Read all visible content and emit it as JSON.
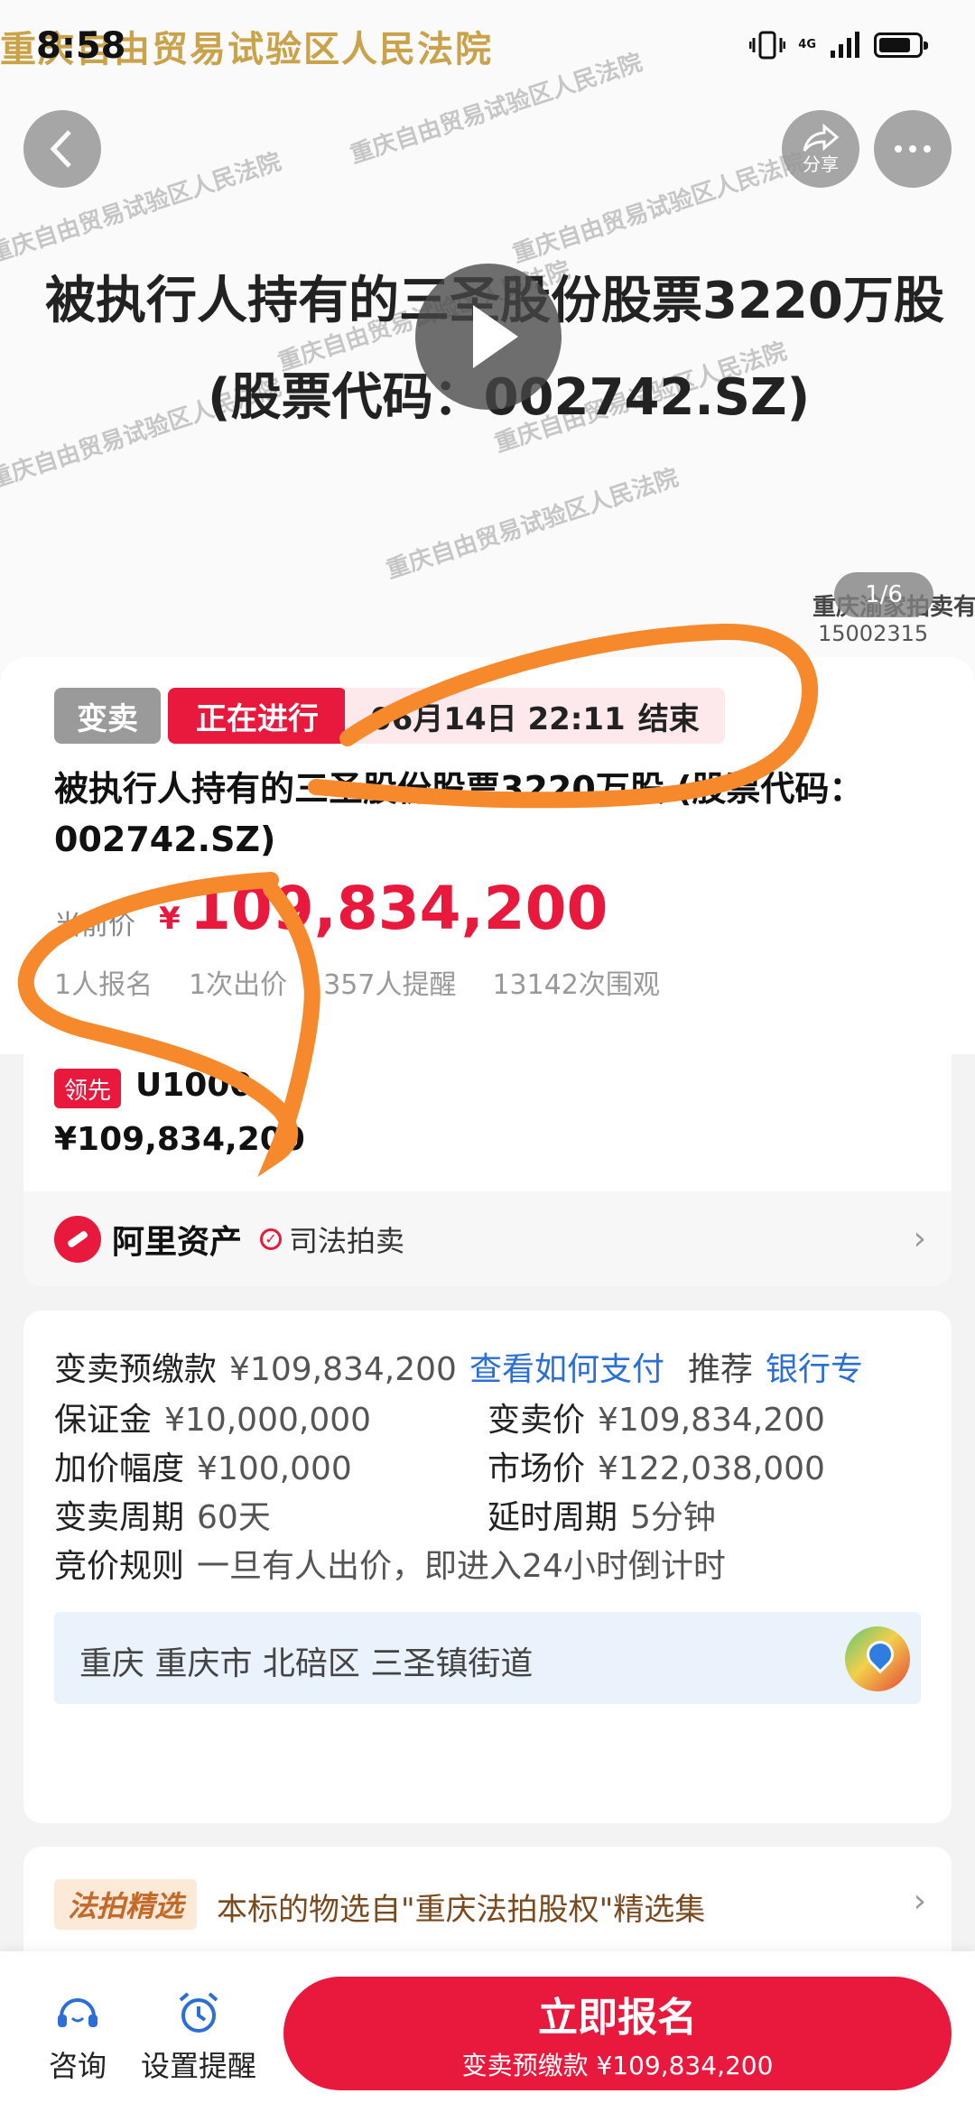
{
  "status_bar": {
    "time": "8:58",
    "banner": "重庆自由贸易试验区人民法院",
    "network": "4G"
  },
  "hero": {
    "watermark": "重庆自由贸易试验区人民法院",
    "title": "被执行人持有的三圣股份股票3220万股",
    "code": "(股票代码：002742.SZ)",
    "share_label": "分享",
    "page_counter": "1/6",
    "seller": "重庆渝家拍卖有",
    "phone": "15002315"
  },
  "info": {
    "tag_type": "变卖",
    "tag_status": "正在进行",
    "end_date": "06月14日 22:11",
    "end_suffix": "结束",
    "title": "被执行人持有的三圣股份股票3220万股 (股票代码：002742.SZ)",
    "price_label": "当前价",
    "currency": "¥",
    "price": "109,834,200",
    "stats": [
      "1人报名",
      "1次出价",
      "357人提醒",
      "13142次围观"
    ]
  },
  "bidder": {
    "lead_badge": "领先",
    "bidder_id": "U1000",
    "amount": "¥109,834,200",
    "platform": "阿里资产",
    "platform_tag": "司法拍卖"
  },
  "details": {
    "deposit_prepay_label": "变卖预缴款",
    "deposit_prepay_value": "¥109,834,200",
    "pay_link": "查看如何支付",
    "recommend": "推荐",
    "bank_link": "银行专",
    "bond_label": "保证金",
    "bond_value": "¥10,000,000",
    "sale_price_label": "变卖价",
    "sale_price_value": "¥109,834,200",
    "increment_label": "加价幅度",
    "increment_value": "¥100,000",
    "market_price_label": "市场价",
    "market_price_value": "¥122,038,000",
    "period_label": "变卖周期",
    "period_value": "60天",
    "delay_label": "延时周期",
    "delay_value": "5分钟",
    "rule_label": "竞价规则",
    "rule_value": "一旦有人出价，即进入24小时倒计时",
    "address": "重庆 重庆市 北碚区 三圣镇街道"
  },
  "featured": {
    "badge": "法拍精选",
    "text": "本标的物选自\"重庆法拍股权\"精选集"
  },
  "bottom_bar": {
    "consult": "咨询",
    "remind": "设置提醒",
    "signup": "立即报名",
    "signup_sub": "变卖预缴款 ¥109,834,200"
  },
  "colors": {
    "accent": "#e8193c",
    "link": "#2b6fd6",
    "annotation": "#f5892b"
  }
}
